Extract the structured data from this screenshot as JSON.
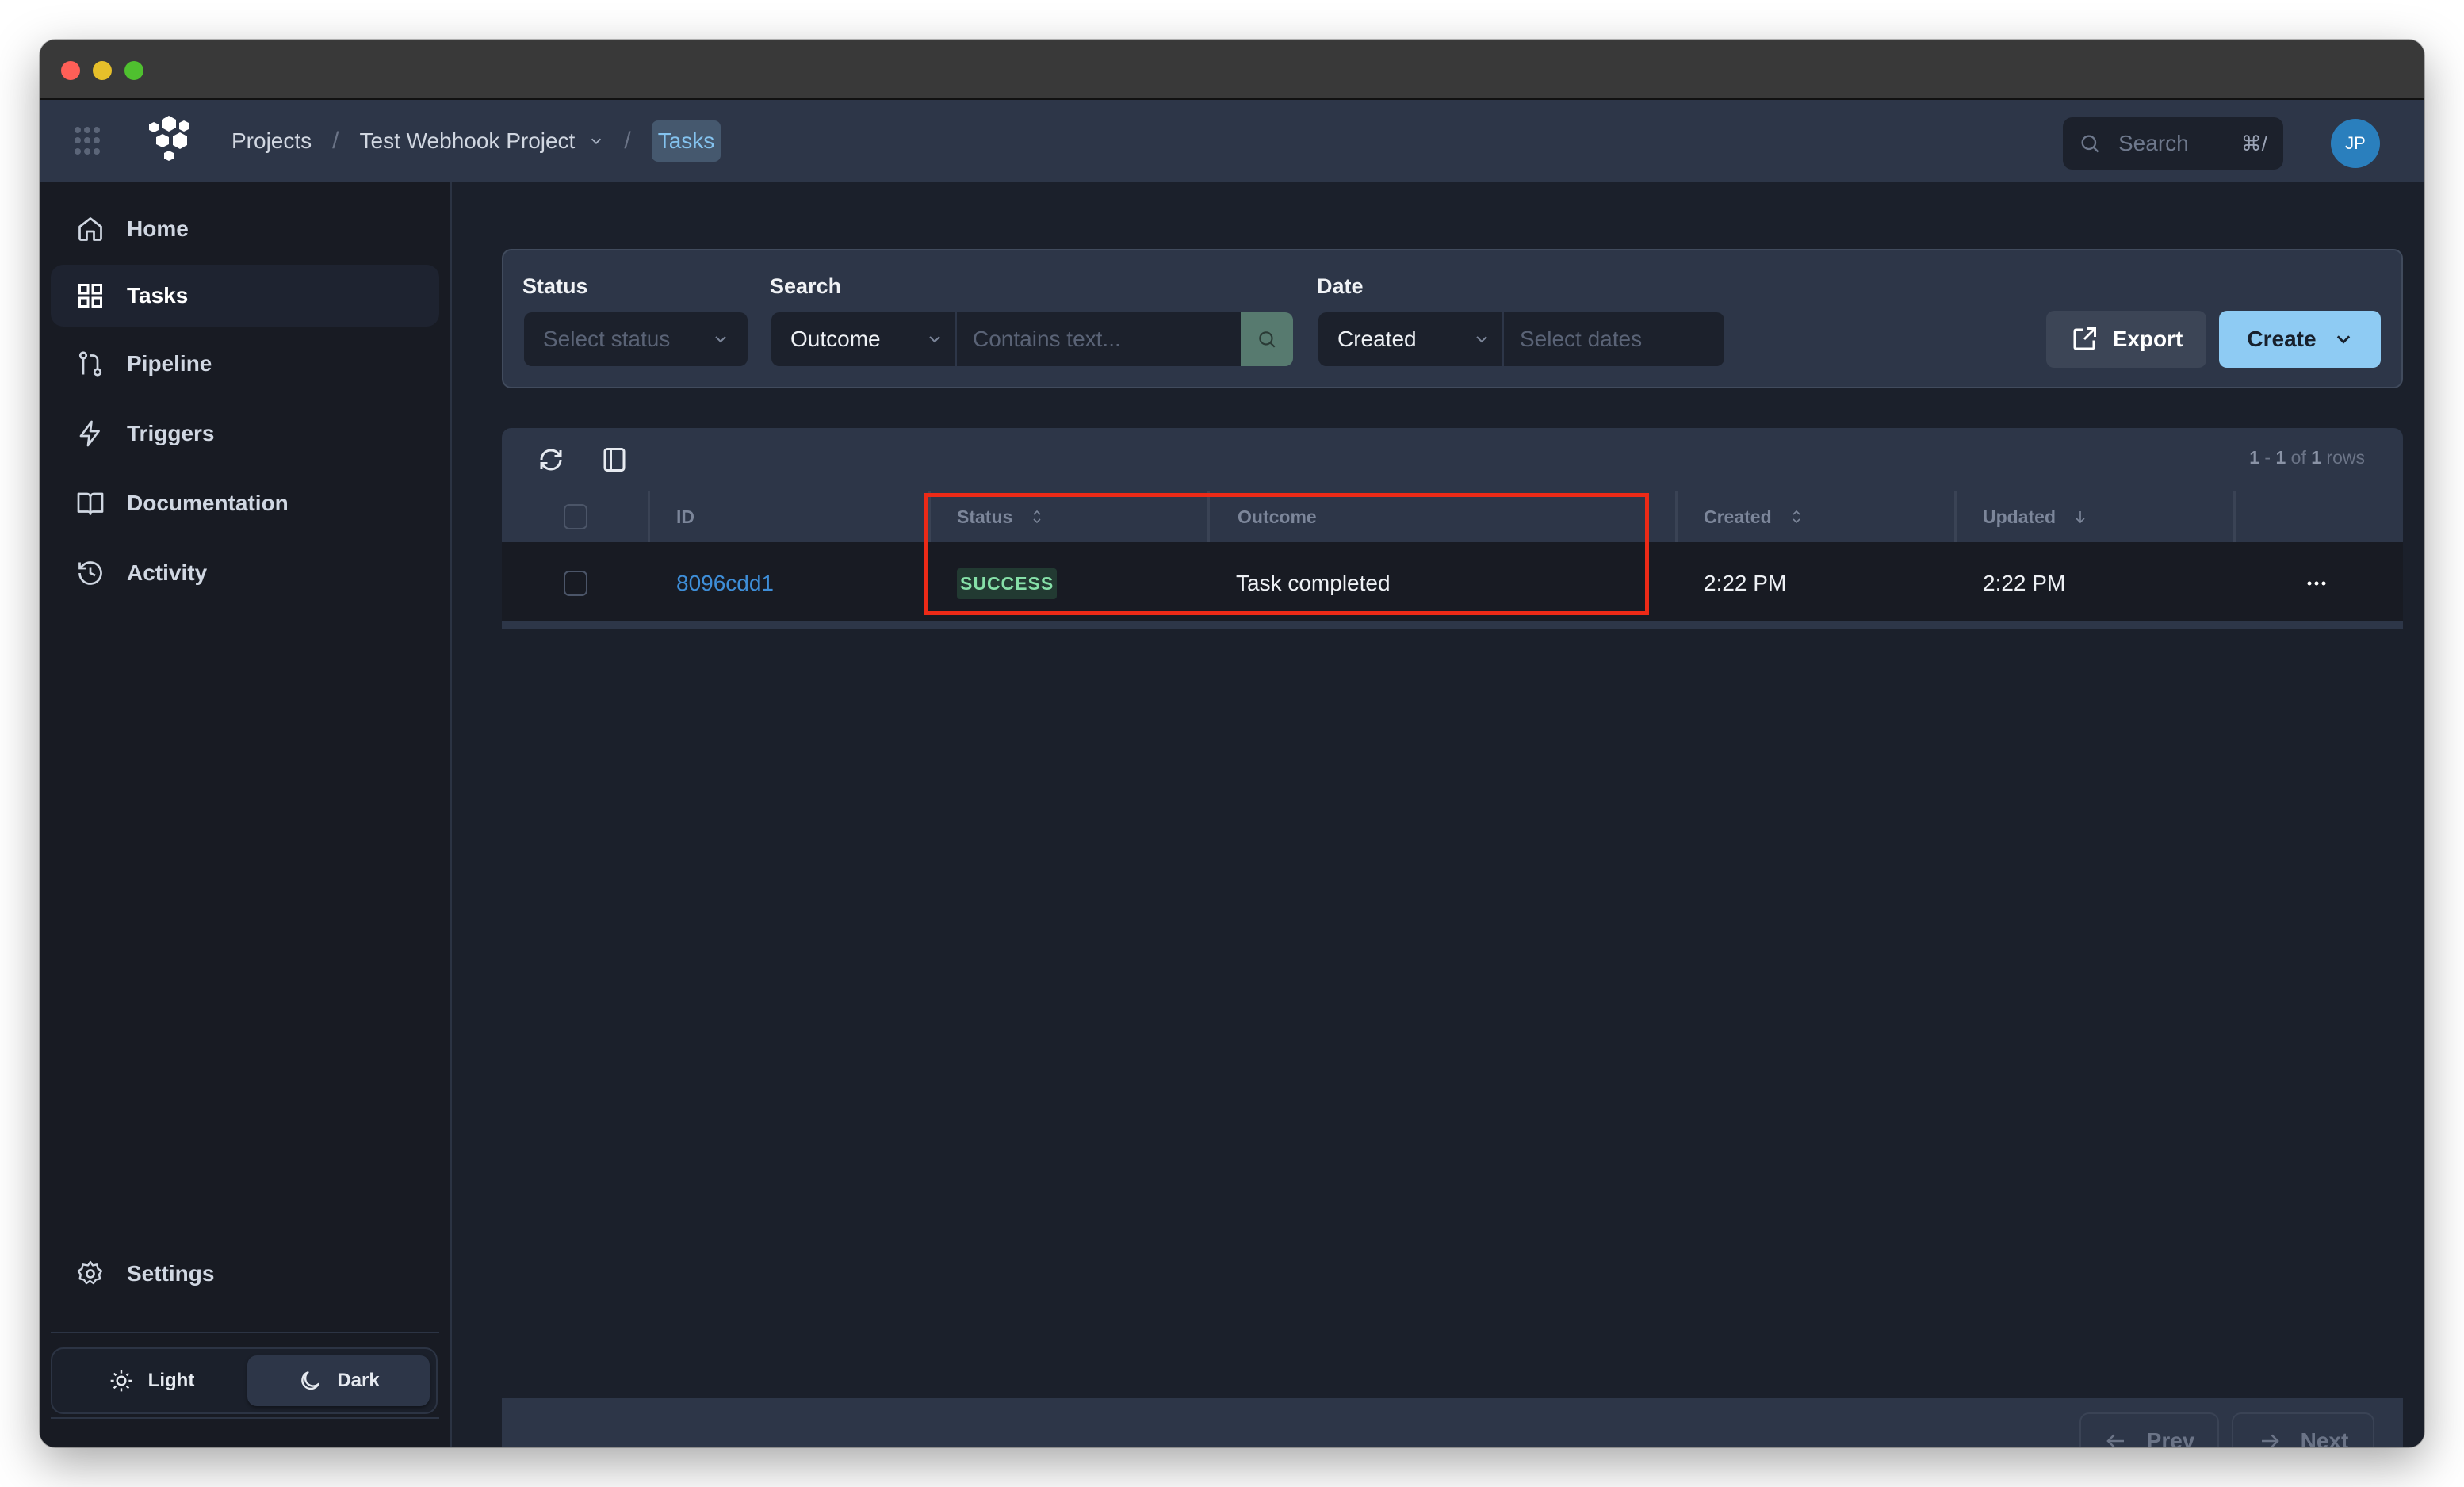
{
  "window": {
    "title_bar_buttons": [
      "close",
      "minimize",
      "maximize"
    ]
  },
  "topbar": {
    "apps_icon": "grid-dots-icon",
    "logo": "hexagon-cluster-logo",
    "breadcrumb": {
      "projects": "Projects",
      "separator": "/",
      "project": "Test Webhook Project",
      "current": "Tasks"
    },
    "search": {
      "placeholder": "Search",
      "shortcut": "⌘/"
    },
    "avatar_initials": "JP"
  },
  "sidebar": {
    "items": [
      {
        "label": "Home",
        "icon": "home-icon",
        "active": false
      },
      {
        "label": "Tasks",
        "icon": "grid-icon",
        "active": true
      },
      {
        "label": "Pipeline",
        "icon": "git-branch-icon",
        "active": false
      },
      {
        "label": "Triggers",
        "icon": "lightning-icon",
        "active": false
      },
      {
        "label": "Documentation",
        "icon": "book-icon",
        "active": false
      },
      {
        "label": "Activity",
        "icon": "history-icon",
        "active": false
      }
    ],
    "settings_label": "Settings",
    "theme": {
      "light_label": "Light",
      "dark_label": "Dark",
      "selected": "Dark"
    },
    "collapse_label": "Collapse Sidebar"
  },
  "filters": {
    "status": {
      "label": "Status",
      "placeholder": "Select status"
    },
    "search": {
      "label": "Search",
      "field_value": "Outcome",
      "text_placeholder": "Contains text..."
    },
    "date": {
      "label": "Date",
      "field_value": "Created",
      "range_placeholder": "Select dates"
    },
    "export_label": "Export",
    "create_label": "Create"
  },
  "table": {
    "rows_summary": {
      "start": "1",
      "dash": " - ",
      "end": "1",
      "of": " of ",
      "total": "1",
      "suffix": " rows"
    },
    "columns": [
      {
        "label": "ID",
        "sort": "none"
      },
      {
        "label": "Status",
        "sort": "sortable"
      },
      {
        "label": "Outcome",
        "sort": "none"
      },
      {
        "label": "Created",
        "sort": "sortable"
      },
      {
        "label": "Updated",
        "sort": "descending"
      }
    ],
    "rows": [
      {
        "id": "8096cdd1",
        "status": "SUCCESS",
        "outcome": "Task completed",
        "created": "2:22 PM",
        "updated": "2:22 PM"
      }
    ]
  },
  "pagination": {
    "prev_label": "Prev",
    "next_label": "Next"
  },
  "colors": {
    "accent": "#8ecbf3",
    "link": "#3e8ed8",
    "success_text": "#86e0a8",
    "success_bg": "#223a32",
    "highlight_box": "#ec2a17"
  }
}
